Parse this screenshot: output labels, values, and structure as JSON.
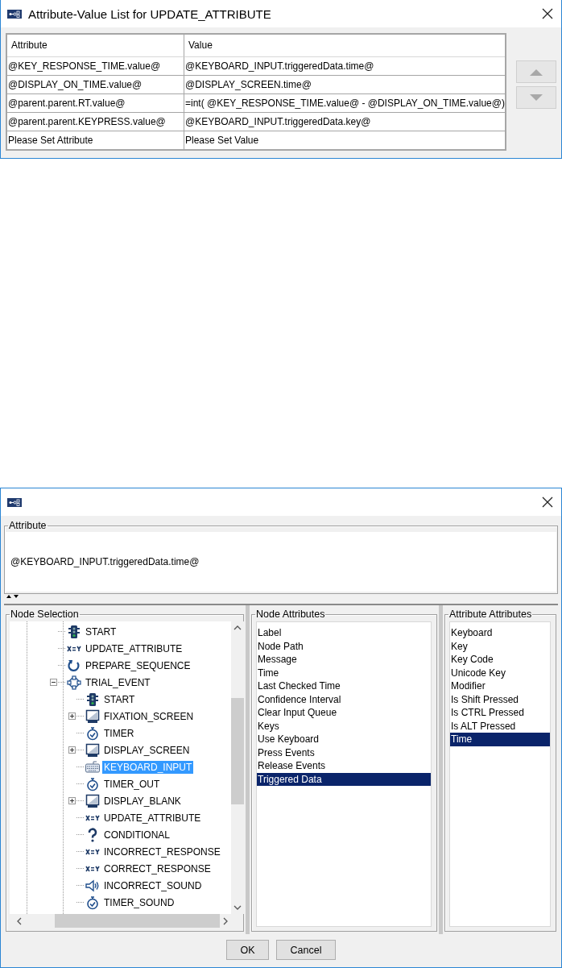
{
  "attribute_value_dialog": {
    "title": "Attribute-Value List for UPDATE_ATTRIBUTE",
    "table": {
      "columns": [
        "Attribute",
        "Value"
      ],
      "rows": [
        [
          "@KEY_RESPONSE_TIME.value@",
          "@KEYBOARD_INPUT.triggeredData.time@"
        ],
        [
          "@DISPLAY_ON_TIME.value@",
          "@DISPLAY_SCREEN.time@"
        ],
        [
          "@parent.parent.RT.value@",
          "=int( @KEY_RESPONSE_TIME.value@ - @DISPLAY_ON_TIME.value@)"
        ],
        [
          "@parent.parent.KEYPRESS.value@",
          "@KEYBOARD_INPUT.triggeredData.key@"
        ],
        [
          "Please Set Attribute",
          "Please Set Value"
        ]
      ]
    },
    "move_buttons": [
      {
        "kind": "up",
        "disabled": true
      },
      {
        "kind": "down",
        "disabled": true
      }
    ]
  },
  "attribute_dialog": {
    "attribute": {
      "label": "Attribute",
      "value": "@KEYBOARD_INPUT.triggeredData.time@"
    },
    "node_selection": {
      "label": "Node Selection",
      "tree": [
        {
          "label": "START",
          "kind": "start",
          "selected": false
        },
        {
          "label": "UPDATE_ATTRIBUTE",
          "kind": "assign",
          "selected": false
        },
        {
          "label": "PREPARE_SEQUENCE",
          "kind": "prepare",
          "selected": false
        },
        {
          "label": "TRIAL_EVENT",
          "kind": "sequence",
          "selected": false,
          "expanded": true,
          "children": [
            {
              "label": "START",
              "kind": "start",
              "selected": false
            },
            {
              "label": "FIXATION_SCREEN",
              "kind": "display",
              "selected": false,
              "expanded": false
            },
            {
              "label": "TIMER",
              "kind": "timer",
              "selected": false
            },
            {
              "label": "DISPLAY_SCREEN",
              "kind": "display",
              "selected": false,
              "expanded": false
            },
            {
              "label": "KEYBOARD_INPUT",
              "kind": "keyboard",
              "selected": true
            },
            {
              "label": "TIMER_OUT",
              "kind": "timer",
              "selected": false
            },
            {
              "label": "DISPLAY_BLANK",
              "kind": "display",
              "selected": false,
              "expanded": false
            },
            {
              "label": "UPDATE_ATTRIBUTE",
              "kind": "assign",
              "selected": false
            },
            {
              "label": "CONDITIONAL",
              "kind": "conditional",
              "selected": false
            },
            {
              "label": "INCORRECT_RESPONSE",
              "kind": "assign",
              "selected": false
            },
            {
              "label": "CORRECT_RESPONSE",
              "kind": "assign",
              "selected": false
            },
            {
              "label": "INCORRECT_SOUND",
              "kind": "sound",
              "selected": false
            },
            {
              "label": "TIMER_SOUND",
              "kind": "timer",
              "selected": false
            }
          ]
        }
      ]
    },
    "node_attributes": {
      "label": "Node Attributes",
      "items": [
        {
          "label": "Label",
          "selected": false
        },
        {
          "label": "Node Path",
          "selected": false
        },
        {
          "label": "Message",
          "selected": false
        },
        {
          "label": "Time",
          "selected": false
        },
        {
          "label": "Last Checked Time",
          "selected": false
        },
        {
          "label": "Confidence Interval",
          "selected": false
        },
        {
          "label": "Clear Input Queue",
          "selected": false
        },
        {
          "label": "Keys",
          "selected": false
        },
        {
          "label": "Use Keyboard",
          "selected": false
        },
        {
          "label": "Press Events",
          "selected": false
        },
        {
          "label": "Release Events",
          "selected": false
        },
        {
          "label": "Triggered Data",
          "selected": true
        }
      ]
    },
    "attribute_attributes": {
      "label": "Attribute Attributes",
      "items": [
        {
          "label": "Keyboard",
          "selected": false
        },
        {
          "label": "Key",
          "selected": false
        },
        {
          "label": "Key Code",
          "selected": false
        },
        {
          "label": "Unicode Key",
          "selected": false
        },
        {
          "label": "Modifier",
          "selected": false
        },
        {
          "label": "Is Shift Pressed",
          "selected": false
        },
        {
          "label": "Is CTRL Pressed",
          "selected": false
        },
        {
          "label": "Is ALT Pressed",
          "selected": false
        },
        {
          "label": "Time",
          "selected": true
        }
      ]
    },
    "buttons": [
      "OK",
      "Cancel"
    ]
  }
}
